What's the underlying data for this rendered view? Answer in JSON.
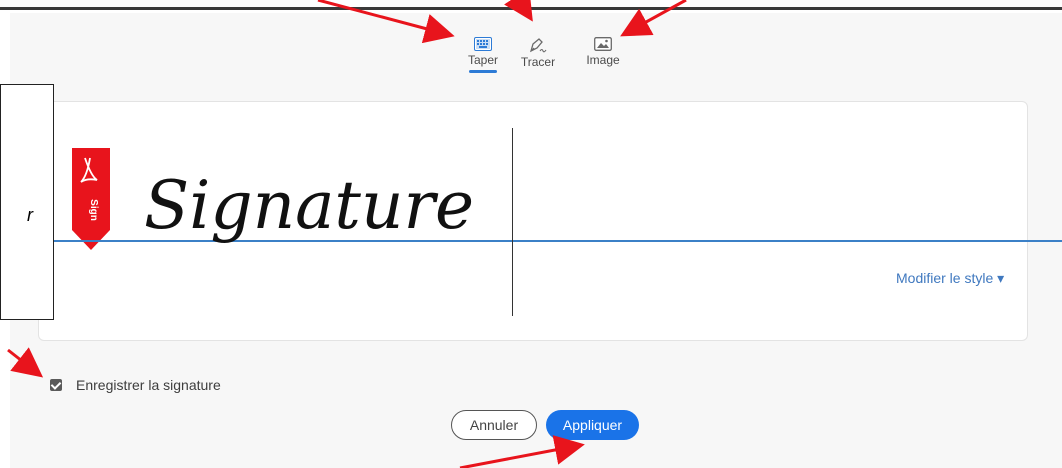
{
  "tabs": [
    {
      "label": "Taper",
      "icon": "keyboard-icon",
      "active": true
    },
    {
      "label": "Tracer",
      "icon": "pen-draw-icon",
      "active": false
    },
    {
      "label": "Image",
      "icon": "image-icon",
      "active": false
    }
  ],
  "signature": {
    "text": "Signature",
    "ribbon_label": "Sign",
    "modify_style_label": "Modifier le style",
    "modify_style_icon": "caret-down-icon"
  },
  "callout": {
    "text": "r"
  },
  "save": {
    "label": "Enregistrer la signature",
    "checked": true
  },
  "buttons": {
    "cancel": "Annuler",
    "apply": "Appliquer"
  },
  "colors": {
    "accent": "#1a73e8",
    "underline": "#2d7bd6",
    "annotation_arrow": "#e8141c",
    "ribbon": "#e8141c"
  }
}
